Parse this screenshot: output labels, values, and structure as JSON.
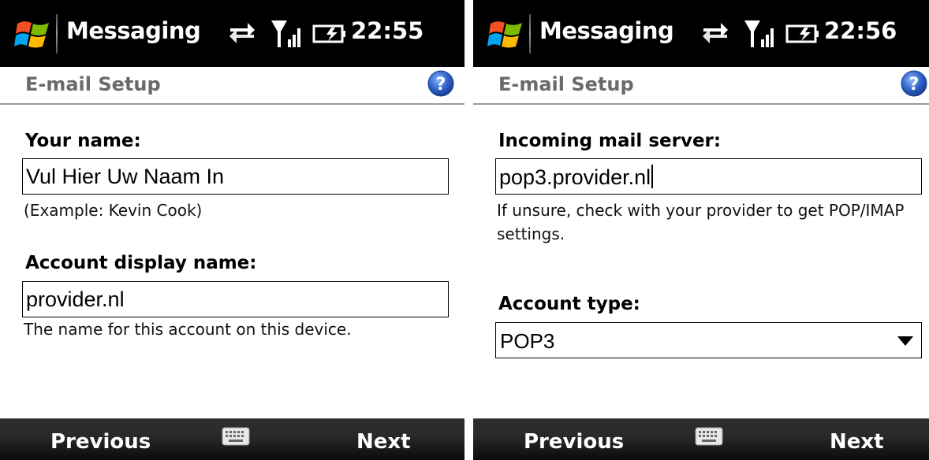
{
  "screens": [
    {
      "status": {
        "app_title": "Messaging",
        "time": "22:55"
      },
      "title": "E-mail Setup",
      "fields": [
        {
          "label": "Your name:",
          "value": "Vul Hier Uw Naam In",
          "hint": "(Example: Kevin Cook)"
        },
        {
          "label": "Account display name:",
          "value": "provider.nl",
          "hint": "The name for this account on this device."
        }
      ],
      "softkeys": {
        "left": "Previous",
        "right": "Next"
      }
    },
    {
      "status": {
        "app_title": "Messaging",
        "time": "22:56"
      },
      "title": "E-mail Setup",
      "incoming": {
        "label": "Incoming mail server:",
        "value": "pop3.provider.nl",
        "hint": "If unsure, check with your provider to get POP/IMAP settings."
      },
      "account_type": {
        "label": "Account type:",
        "selected": "POP3"
      },
      "softkeys": {
        "left": "Previous",
        "right": "Next"
      }
    }
  ],
  "colors": {
    "statusbar": "#000000",
    "help_icon": "#2f63c8",
    "title_text": "#6a6a6a"
  }
}
